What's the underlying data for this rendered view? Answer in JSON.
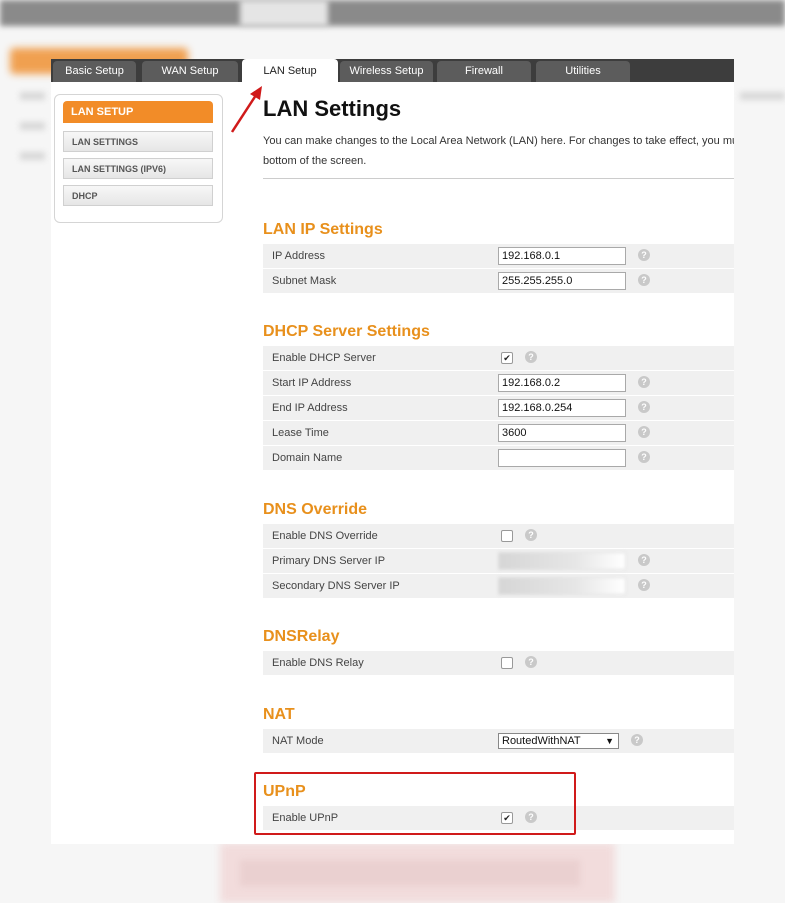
{
  "tabs": [
    {
      "label": "Basic Setup"
    },
    {
      "label": "WAN Setup"
    },
    {
      "label": "LAN Setup",
      "active": true
    },
    {
      "label": "Wireless Setup"
    },
    {
      "label": "Firewall"
    },
    {
      "label": "Utilities"
    }
  ],
  "sidebar": {
    "header": "LAN SETUP",
    "items": [
      {
        "label": "LAN SETTINGS"
      },
      {
        "label": "LAN SETTINGS (IPV6)"
      },
      {
        "label": "DHCP"
      }
    ]
  },
  "page": {
    "title": "LAN Settings",
    "intro_line1": "You can make changes to the Local Area Network (LAN) here. For changes to take effect, you mus",
    "intro_line2": "bottom of the screen."
  },
  "sections": {
    "lan_ip": {
      "title": "LAN IP Settings",
      "ip_address": {
        "label": "IP Address",
        "value": "192.168.0.1"
      },
      "subnet_mask": {
        "label": "Subnet Mask",
        "value": "255.255.255.0"
      }
    },
    "dhcp": {
      "title": "DHCP Server Settings",
      "enable": {
        "label": "Enable DHCP Server",
        "checked": true
      },
      "start_ip": {
        "label": "Start IP Address",
        "value": "192.168.0.2"
      },
      "end_ip": {
        "label": "End IP Address",
        "value": "192.168.0.254"
      },
      "lease_time": {
        "label": "Lease Time",
        "value": "3600"
      },
      "domain_name": {
        "label": "Domain Name",
        "value": ""
      }
    },
    "dns_override": {
      "title": "DNS Override",
      "enable": {
        "label": "Enable DNS Override",
        "checked": false
      },
      "primary": {
        "label": "Primary DNS Server IP",
        "value": ""
      },
      "secondary": {
        "label": "Secondary DNS Server IP",
        "value": ""
      }
    },
    "dns_relay": {
      "title": "DNSRelay",
      "enable": {
        "label": "Enable DNS Relay",
        "checked": false
      }
    },
    "nat": {
      "title": "NAT",
      "mode": {
        "label": "NAT Mode",
        "value": "RoutedWithNAT"
      }
    },
    "upnp": {
      "title": "UPnP",
      "enable": {
        "label": "Enable UPnP",
        "checked": true
      }
    }
  },
  "icons": {
    "help": "?",
    "check": "✔",
    "caret": "▼"
  },
  "colors": {
    "accent_orange": "#e8901c",
    "sidebar_header": "#f28c28",
    "tabbar": "#3d3d3d",
    "annotation_red": "#d01a1a"
  }
}
